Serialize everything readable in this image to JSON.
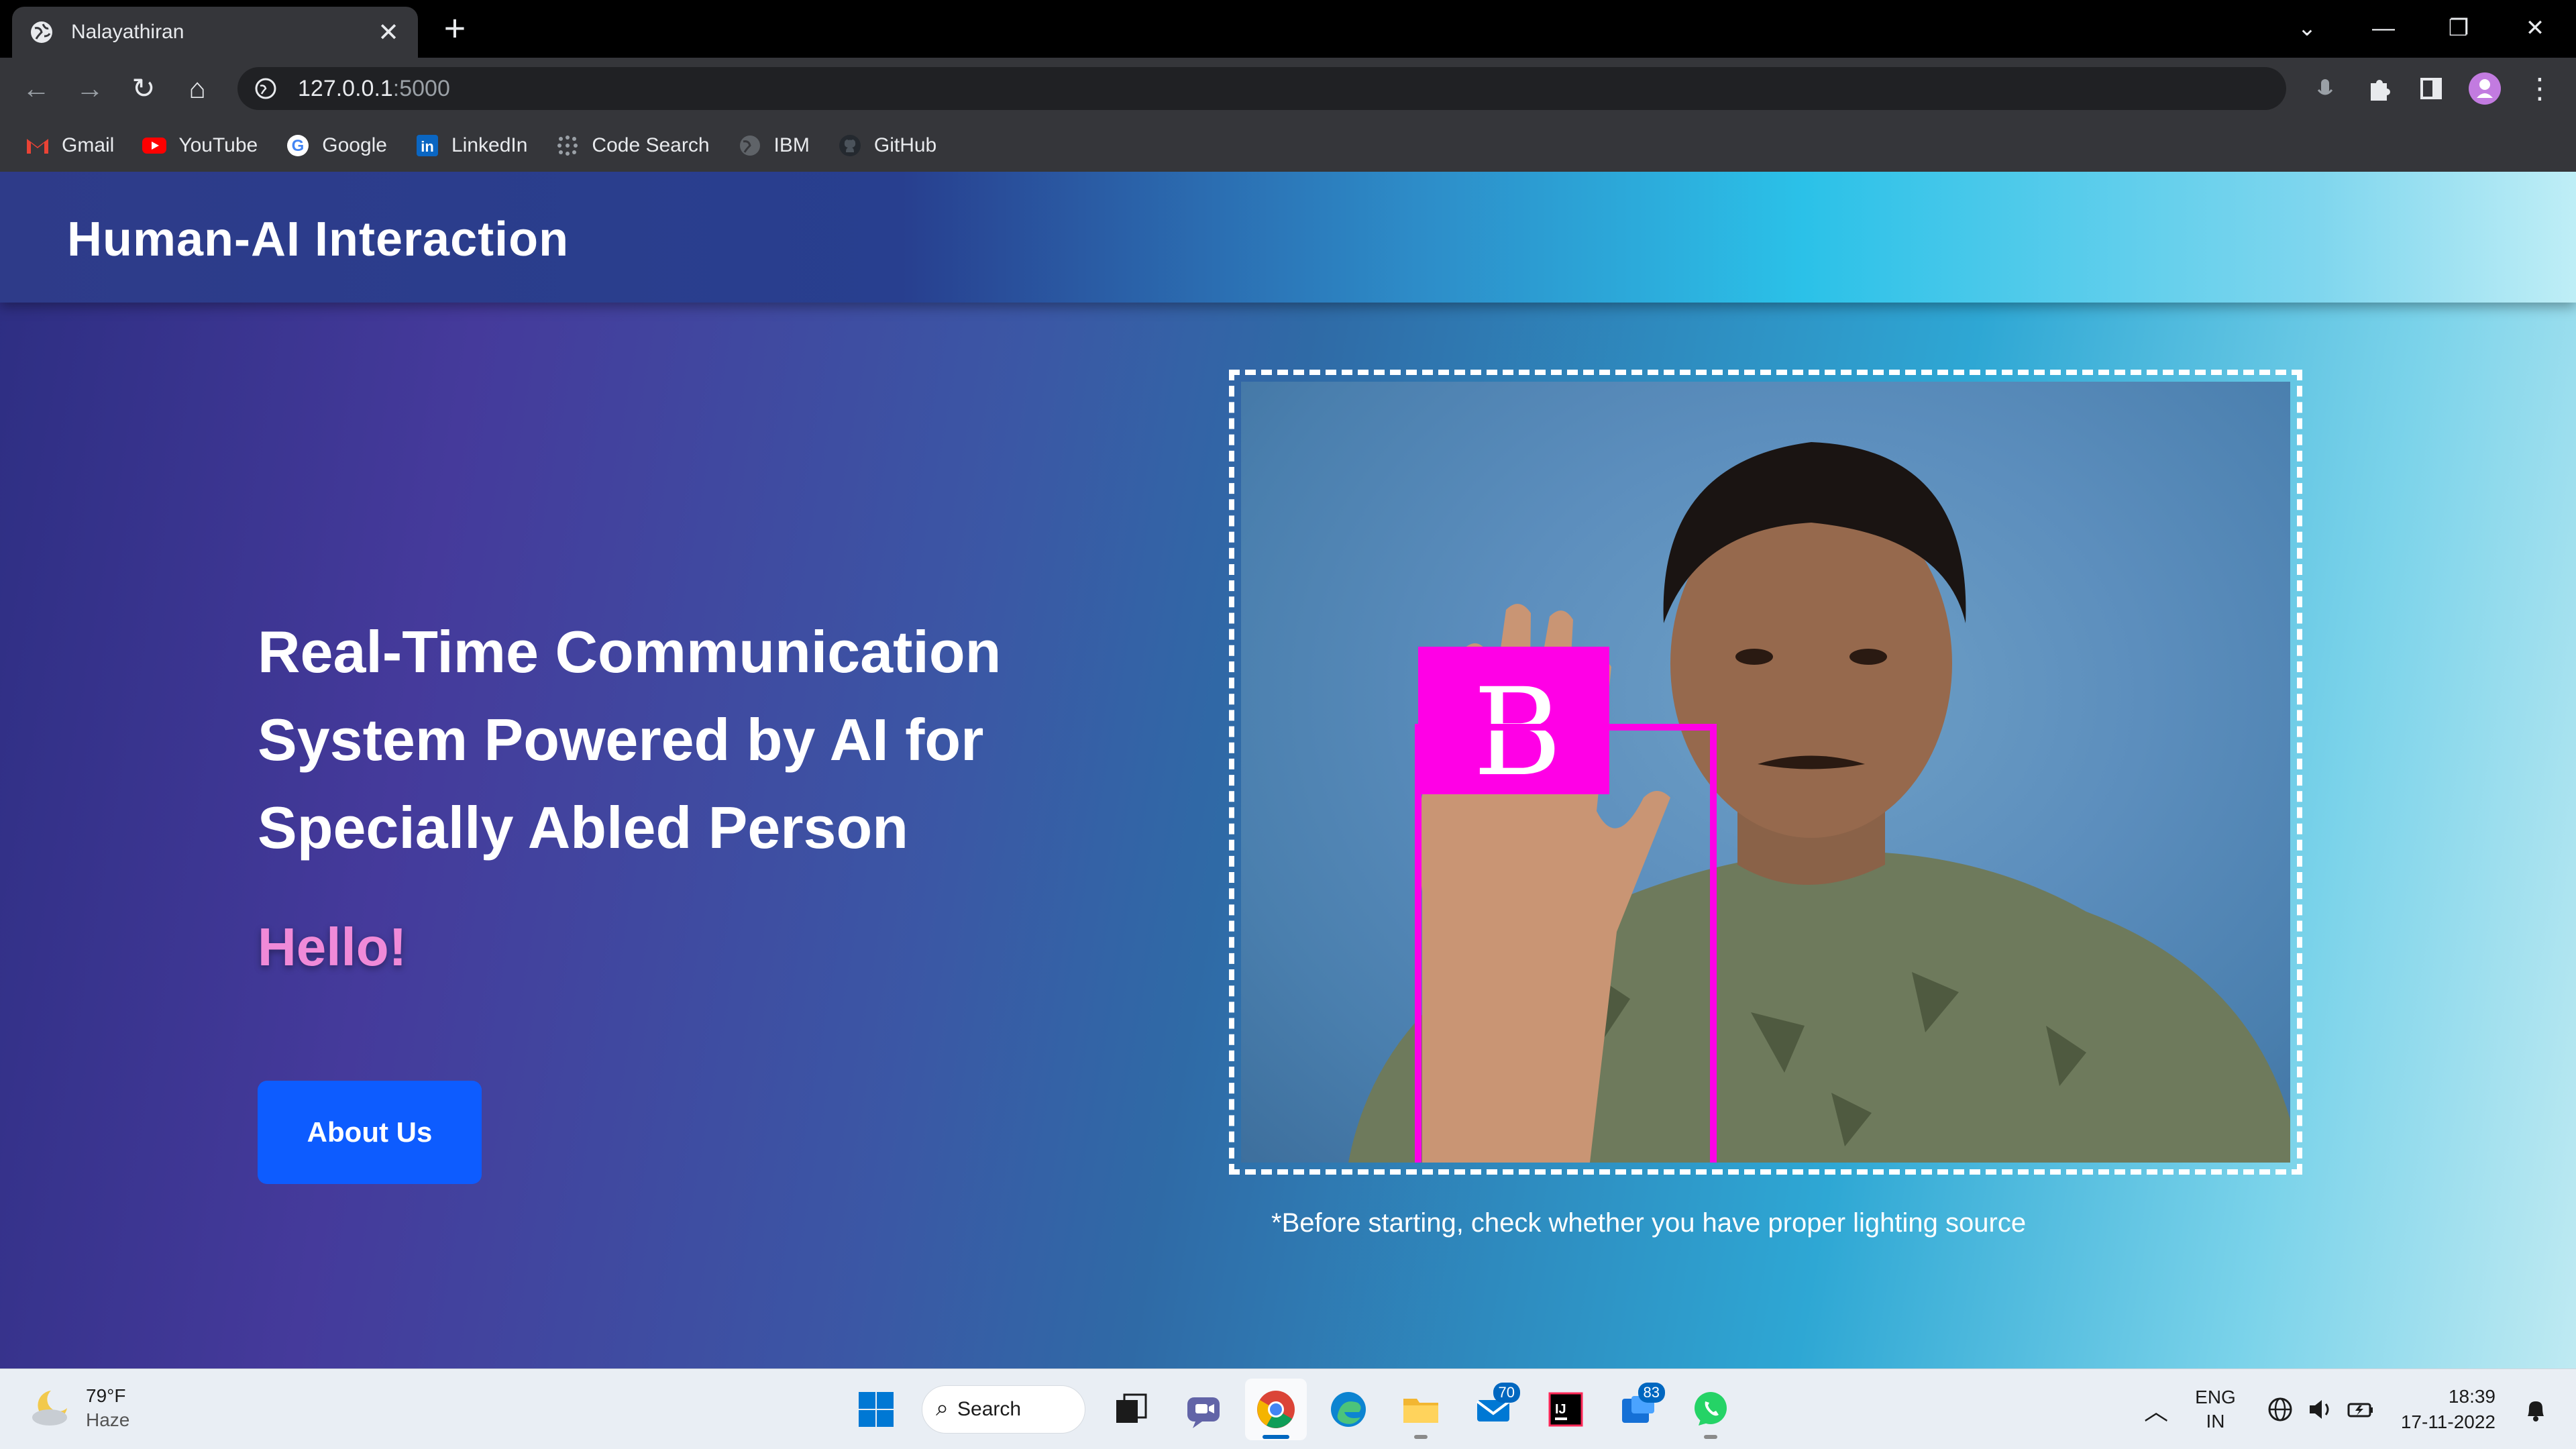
{
  "browser": {
    "tab_title": "Nalayathiran",
    "url_host": "127.0.0.1",
    "url_port": ":5000",
    "bookmarks": [
      {
        "label": "Gmail",
        "icon": "gmail-icon"
      },
      {
        "label": "YouTube",
        "icon": "youtube-icon"
      },
      {
        "label": "Google",
        "icon": "google-icon"
      },
      {
        "label": "LinkedIn",
        "icon": "linkedin-icon"
      },
      {
        "label": "Code Search",
        "icon": "code-search-icon"
      },
      {
        "label": "IBM",
        "icon": "globe-icon"
      },
      {
        "label": "GitHub",
        "icon": "github-icon"
      }
    ]
  },
  "site": {
    "title": "Human-AI Interaction",
    "headline_1": "Real-Time Communication",
    "headline_2": "System Powered by AI for",
    "headline_3": "Specially Abled Person",
    "greeting": "Hello!",
    "about_label": "About Us",
    "detected_letter": "B",
    "note": "*Before starting, check whether you have proper lighting source"
  },
  "colors": {
    "accent_button": "#0d5cff",
    "greeting": "#f08ad8",
    "detection_box": "#ff00e6"
  },
  "taskbar": {
    "weather_temp": "79°F",
    "weather_cond": "Haze",
    "search_label": "Search",
    "mail_badge": "70",
    "teams_badge": "83",
    "lang_1": "ENG",
    "lang_2": "IN",
    "time": "18:39",
    "date": "17-11-2022"
  }
}
